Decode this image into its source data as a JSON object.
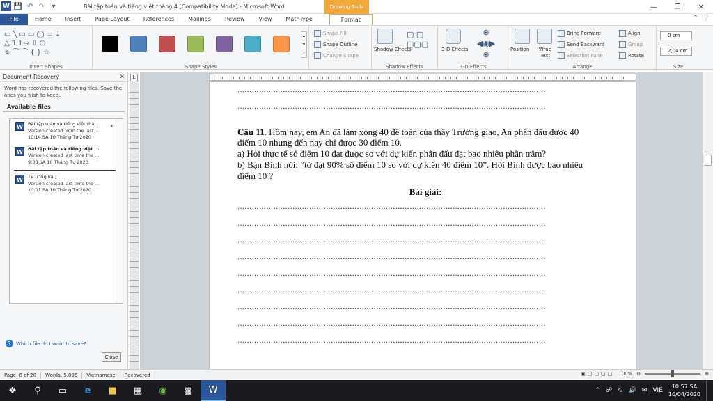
{
  "window": {
    "title": "Bài tập toán và tiếng việt tháng 4 [Compatibility Mode]  -  Microsoft Word",
    "contextual_tab_group": "Drawing Tools"
  },
  "ribbon_tabs": [
    "File",
    "Home",
    "Insert",
    "Page Layout",
    "References",
    "Mailings",
    "Review",
    "View",
    "MathType",
    "Format"
  ],
  "ribbon": {
    "groups": {
      "insert_shapes": "Insert Shapes",
      "shape_styles": "Shape Styles",
      "shadow_effects": "Shadow Effects",
      "three_d_effects": "3-D Effects",
      "arrange": "Arrange",
      "size": "Size"
    },
    "shape_fill": "Shape Fill",
    "shape_outline": "Shape Outline",
    "change_shape": "Change Shape",
    "shadow_effects_btn": "Shadow Effects",
    "three_d_btn": "3-D Effects",
    "position": "Position",
    "wrap_text": "Wrap Text",
    "bring_forward": "Bring Forward",
    "send_backward": "Send Backward",
    "selection_pane": "Selection Pane",
    "align": "Align",
    "group": "Group",
    "rotate": "Rotate",
    "height_value": "0 cm",
    "width_value": "2,04 cm",
    "style_colors": [
      "#000000",
      "#4f81bd",
      "#c0504d",
      "#9bbb59",
      "#8064a2",
      "#4bacc6",
      "#f79646"
    ]
  },
  "recovery_pane": {
    "title": "Document Recovery",
    "message": "Word has recovered the following files.  Save the ones you wish to keep.",
    "available_label": "Available files",
    "files": [
      {
        "name": "Bài tập toán và tiếng việt thá...",
        "line2": "Version created from the last ...",
        "line3": "10:14 SA 10 Tháng Tư 2020"
      },
      {
        "name": "Bài tập toán và tiếng việt ...",
        "line2": "Version created last time the ...",
        "line3": "9:38 SA 10 Tháng Tư 2020"
      },
      {
        "name": "TV  [Original]",
        "line2": "Version created last time the ...",
        "line3": "10:01 SA 10 Tháng Tư 2020"
      }
    ],
    "which_link": "Which file do I want to save?",
    "close_button": "Close"
  },
  "document": {
    "dots": "…………………………………………………………………………………………………………………",
    "q_bold": "Câu 11",
    "q_line1": ". Hôm nay, em An đã làm xong 40 đề toán của thầy Trường giao, An phấn đấu được 40",
    "q_line2": "điểm 10 nhưng đến nay chỉ được 30 điểm 10.",
    "q_line3": "a) Hỏi thực tế số điểm 10 đạt được so với dự kiến phấn đấu đạt bao nhiêu phần trăm?",
    "q_line4": "b) Bạn Bình nói: “tớ đạt 90% số điểm 10 so với dự kiến 40 điểm 10”. Hỏi Bình được bao nhiêu",
    "q_line5": "điểm 10 ?",
    "solution_heading": "Bài giải:"
  },
  "statusbar": {
    "page": "Page: 6 of 20",
    "words": "Words: 5.096",
    "language": "Vietnamese",
    "mode": "Recovered",
    "zoom": "100%"
  },
  "taskbar": {
    "language": "VIE",
    "time": "10:57 SA",
    "date": "10/04/2020"
  }
}
